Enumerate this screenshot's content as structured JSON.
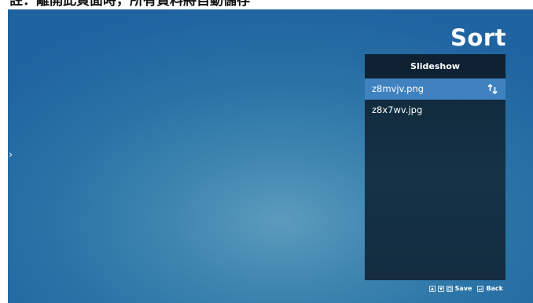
{
  "caption": "註：離開此頁面時，所有資料將自動儲存",
  "screen": {
    "left_nav_glyph": "›",
    "title": "Sort"
  },
  "panel": {
    "header": "Slideshow",
    "files": [
      {
        "name": "z8mvjv.png",
        "selected": true
      },
      {
        "name": "z8x7wv.jpg",
        "selected": false
      }
    ]
  },
  "hints": {
    "save_label": "Save",
    "back_label": "Back"
  },
  "icons": {
    "left": "chevron-right-icon",
    "sort": "sort-arrows-icon",
    "keys": [
      "up-key-icon",
      "down-key-icon",
      "ok-key-icon",
      "back-key-icon"
    ]
  },
  "colors": {
    "screen_bg": "#2a73a6",
    "panel_bg": "#153247",
    "panel_header_bg": "#0e2233",
    "selected_row": "#3f82bf",
    "text": "#ffffff"
  }
}
